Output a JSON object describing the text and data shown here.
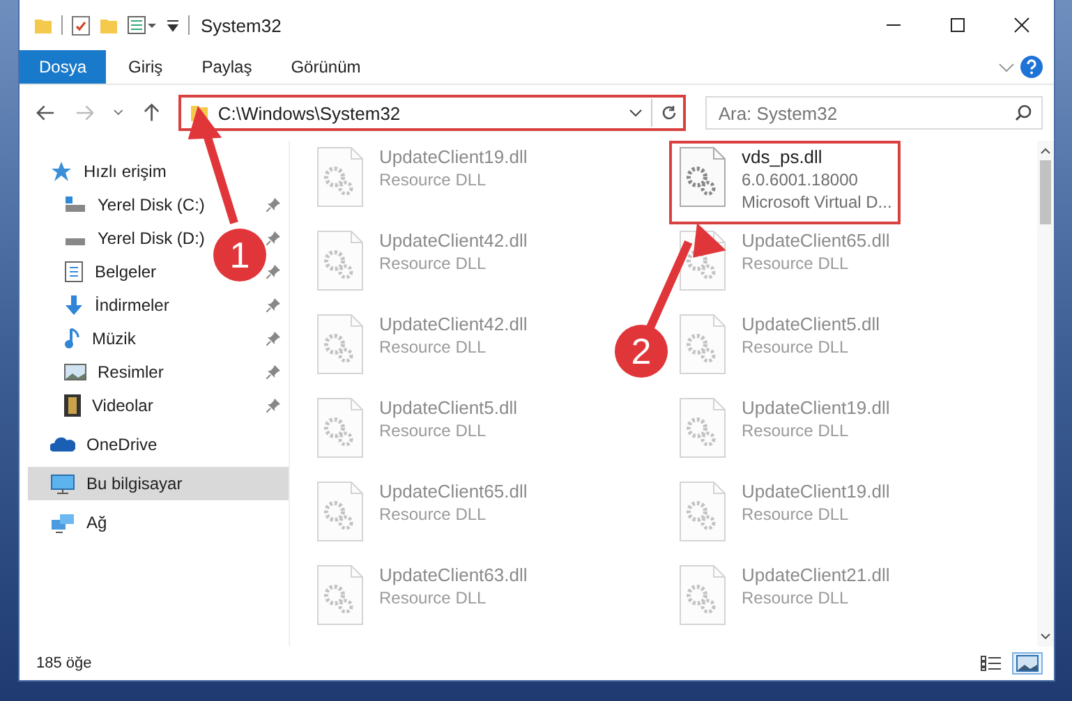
{
  "window": {
    "title": "System32"
  },
  "ribbon_tabs": [
    {
      "label": "Dosya",
      "selected": true
    },
    {
      "label": "Giriş",
      "selected": false
    },
    {
      "label": "Paylaş",
      "selected": false
    },
    {
      "label": "Görünüm",
      "selected": false
    }
  ],
  "address_bar": {
    "path": "C:\\Windows\\System32",
    "highlighted": true
  },
  "search": {
    "placeholder": "Ara: System32"
  },
  "sidebar": {
    "items": [
      {
        "label": "Hızlı erişim",
        "selected": false,
        "children": [
          {
            "label": "Yerel Disk (C:)",
            "pinned": true,
            "selected": false
          },
          {
            "label": "Yerel Disk (D:)",
            "pinned": true,
            "selected": false
          },
          {
            "label": "Belgeler",
            "pinned": true,
            "selected": false
          },
          {
            "label": "İndirmeler",
            "pinned": true,
            "selected": false
          },
          {
            "label": "Müzik",
            "pinned": true,
            "selected": false
          },
          {
            "label": "Resimler",
            "pinned": true,
            "selected": false
          },
          {
            "label": "Videolar",
            "pinned": true,
            "selected": false
          }
        ]
      },
      {
        "label": "OneDrive",
        "selected": false
      },
      {
        "label": "Bu bilgisayar",
        "selected": true
      },
      {
        "label": "Ağ",
        "selected": false
      }
    ]
  },
  "files": [
    {
      "name": "UpdateClient19.dll",
      "lines": [
        "Resource DLL"
      ],
      "highlighted": false,
      "faded": true
    },
    {
      "name": "vds_ps.dll",
      "lines": [
        "6.0.6001.18000",
        "Microsoft Virtual D..."
      ],
      "highlighted": true,
      "faded": false
    },
    {
      "name": "UpdateClient42.dll",
      "lines": [
        "Resource DLL"
      ],
      "highlighted": false,
      "faded": true
    },
    {
      "name": "UpdateClient65.dll",
      "lines": [
        "Resource DLL"
      ],
      "highlighted": false,
      "faded": true
    },
    {
      "name": "UpdateClient42.dll",
      "lines": [
        "Resource DLL"
      ],
      "highlighted": false,
      "faded": true
    },
    {
      "name": "UpdateClient5.dll",
      "lines": [
        "Resource DLL"
      ],
      "highlighted": false,
      "faded": true
    },
    {
      "name": "UpdateClient5.dll",
      "lines": [
        "Resource DLL"
      ],
      "highlighted": false,
      "faded": true
    },
    {
      "name": "UpdateClient19.dll",
      "lines": [
        "Resource DLL"
      ],
      "highlighted": false,
      "faded": true
    },
    {
      "name": "UpdateClient65.dll",
      "lines": [
        "Resource DLL"
      ],
      "highlighted": false,
      "faded": true
    },
    {
      "name": "UpdateClient19.dll",
      "lines": [
        "Resource DLL"
      ],
      "highlighted": false,
      "faded": true
    },
    {
      "name": "UpdateClient63.dll",
      "lines": [
        "Resource DLL"
      ],
      "highlighted": false,
      "faded": true
    },
    {
      "name": "UpdateClient21.dll",
      "lines": [
        "Resource DLL"
      ],
      "highlighted": false,
      "faded": true
    }
  ],
  "status_bar": {
    "count": "185 öğe"
  },
  "view_buttons": [
    {
      "selected": false
    },
    {
      "selected": true
    }
  ],
  "annotations": [
    {
      "label": "1"
    },
    {
      "label": "2"
    }
  ]
}
